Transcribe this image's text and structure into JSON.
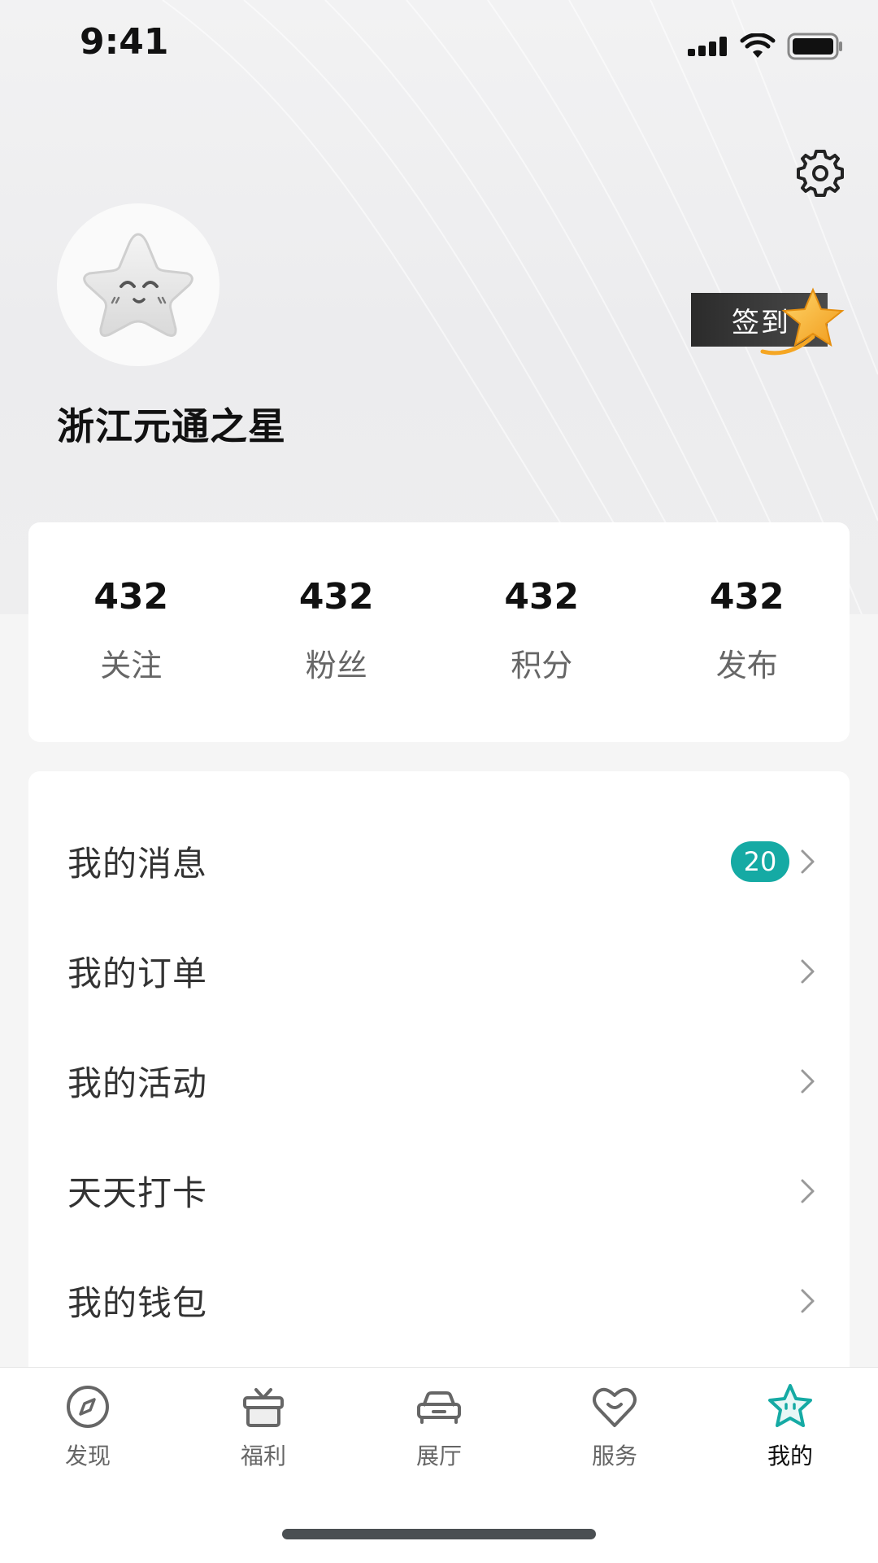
{
  "status_bar": {
    "time": "9:41"
  },
  "profile": {
    "username": "浙江元通之星",
    "checkin_label": "签到"
  },
  "stats": [
    {
      "value": "432",
      "label": "关注"
    },
    {
      "value": "432",
      "label": "粉丝"
    },
    {
      "value": "432",
      "label": "积分"
    },
    {
      "value": "432",
      "label": "发布"
    }
  ],
  "menu": [
    {
      "label": "我的消息",
      "badge": "20"
    },
    {
      "label": "我的订单"
    },
    {
      "label": "我的活动"
    },
    {
      "label": "天天打卡"
    },
    {
      "label": "我的钱包"
    }
  ],
  "tabs": [
    {
      "label": "发现",
      "icon": "compass-icon"
    },
    {
      "label": "福利",
      "icon": "gift-icon"
    },
    {
      "label": "展厅",
      "icon": "car-icon"
    },
    {
      "label": "服务",
      "icon": "heart-smile-icon"
    },
    {
      "label": "我的",
      "icon": "star-face-icon",
      "active": true
    }
  ],
  "colors": {
    "accent": "#15aaa4",
    "checkin_star": "#f5a623"
  }
}
